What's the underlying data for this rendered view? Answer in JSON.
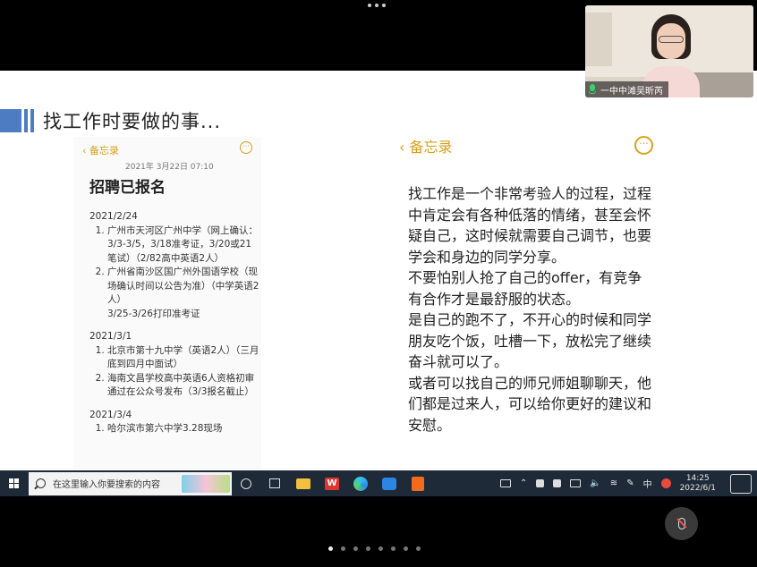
{
  "slide": {
    "title": "找工作时要做的事...",
    "left_memo": {
      "back_label": "备忘录",
      "more_label": "···",
      "timestamp": "2021年 3月22日 07:10",
      "heading": "招聘已报名",
      "sections": [
        {
          "date": "2021/2/24",
          "items": [
            "广州市天河区广州中学（网上确认：3/3-3/5，3/18准考证，3/20或21笔试）（2/82高中英语2人）",
            "广州省南沙区国广州外国语学校（现场确认时间以公告为准）（中学英语2人）"
          ],
          "note": "3/25-3/26打印准考证"
        },
        {
          "date": "2021/3/1",
          "items": [
            "北京市第十九中学（英语2人）（三月底到四月中面试）",
            "海南文昌学校高中英语6人资格初审通过在公众号发布（3/3报名截止）"
          ],
          "note": ""
        },
        {
          "date": "2021/3/4",
          "items": [
            "哈尔滨市第六中学3.28现场"
          ],
          "note": ""
        }
      ]
    },
    "right_memo": {
      "back_label": "备忘录",
      "more_label": "···",
      "paragraphs": [
        "找工作是一个非常考验人的过程，过程中肯定会有各种低落的情绪，甚至会怀疑自己，这时候就需要自己调节，也要学会和身边的同学分享。",
        "不要怕别人抢了自己的offer，有竞争有合作才是最舒服的状态。",
        "是自己的跑不了，不开心的时候和同学朋友吃个饭，吐槽一下，放松完了继续奋斗就可以了。",
        "或者可以找自己的师兄师姐聊聊天，他们都是过来人，可以给你更好的建议和安慰。"
      ]
    }
  },
  "video_tile": {
    "participant_name": "一中中滩吴昕芮"
  },
  "taskbar": {
    "search_placeholder": "在这里输入你要搜索的内容",
    "wps_label": "W",
    "ime_label": "中",
    "time": "14:25",
    "date": "2022/6/1"
  },
  "pager": {
    "count": 8,
    "active_index": 0
  },
  "colors": {
    "accent": "#4d7cc2",
    "memo_gold": "#d7a21a",
    "mic_green": "#37d36a"
  }
}
